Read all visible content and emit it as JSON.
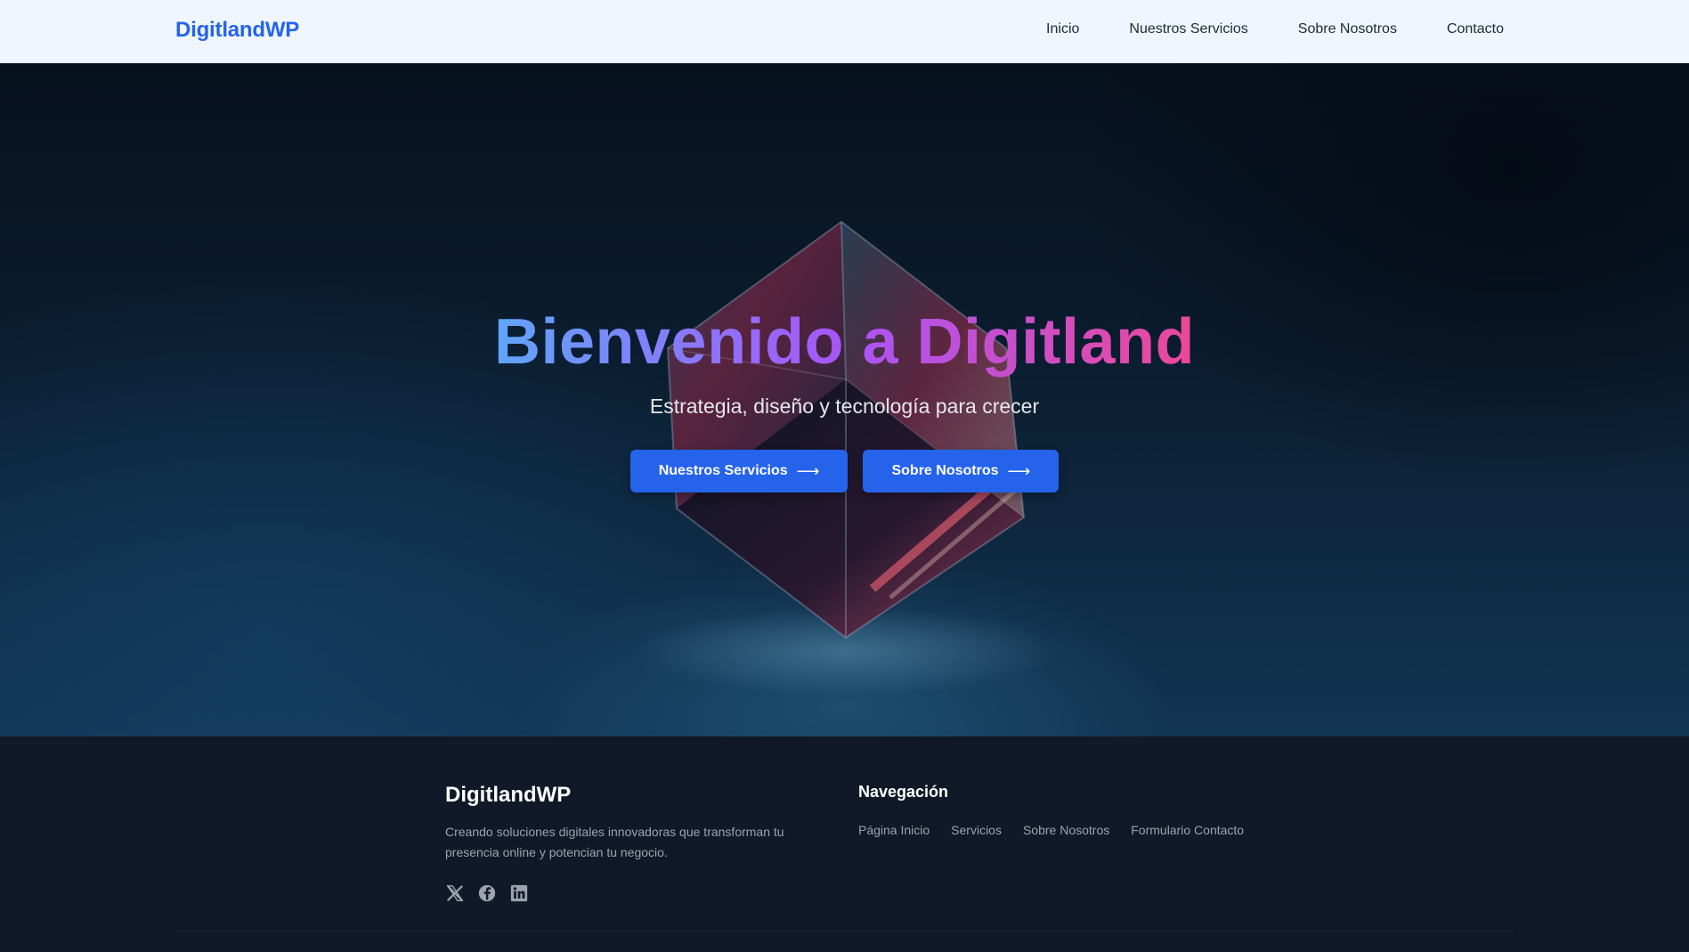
{
  "header": {
    "logo": "DigitlandWP",
    "nav": [
      {
        "label": "Inicio"
      },
      {
        "label": "Nuestros Servicios"
      },
      {
        "label": "Sobre Nosotros"
      },
      {
        "label": "Contacto"
      }
    ]
  },
  "hero": {
    "title": "Bienvenido a Digitland",
    "subtitle": "Estrategia, diseño y tecnología para crecer",
    "buttons": [
      {
        "label": "Nuestros Servicios",
        "icon": "arrow-right-icon"
      },
      {
        "label": "Sobre Nosotros",
        "icon": "arrow-right-icon"
      }
    ],
    "background_image": "glass-cube"
  },
  "footer": {
    "brand": "DigitlandWP",
    "description": "Creando soluciones digitales innovadoras que transforman tu presencia online y potencian tu negocio.",
    "social": [
      "x-icon",
      "facebook-icon",
      "linkedin-icon"
    ],
    "nav_title": "Navegación",
    "links": [
      {
        "label": "Página Inicio"
      },
      {
        "label": "Servicios"
      },
      {
        "label": "Sobre Nosotros"
      },
      {
        "label": "Formulario Contacto"
      }
    ]
  },
  "colors": {
    "accent": "#2563eb",
    "header_bg": "#eff6ff",
    "footer_bg": "#111827",
    "gradient": [
      "#60a5fa",
      "#a855f7",
      "#ec4899"
    ]
  }
}
